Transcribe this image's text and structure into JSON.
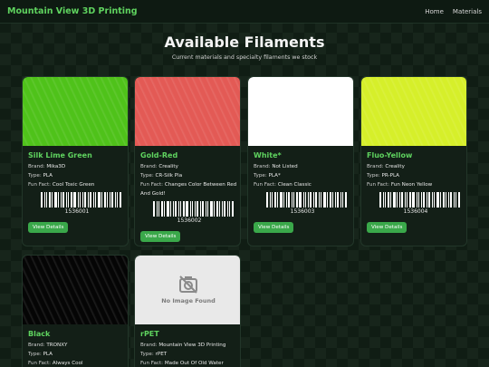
{
  "nav": {
    "brand": "Mountain View 3D Printing",
    "links": [
      "Home",
      "Materials"
    ]
  },
  "hero": {
    "title": "Available Filaments",
    "subtitle": "Current materials and specialty filaments we stock"
  },
  "labels": {
    "brand": "Brand:",
    "type": "Type:",
    "fun_fact": "Fun Fact:",
    "view_details": "View Details",
    "no_image": "No Image Found"
  },
  "filaments": [
    {
      "name": "Silk Lime Green",
      "brand": "Mika3D",
      "type": "PLA",
      "fun_fact": "Cool Toxic Green",
      "code": "1536001",
      "color": "#4fc21a"
    },
    {
      "name": "Gold-Red",
      "brand": "Creality",
      "type": "CR-Silk Pla",
      "fun_fact": "Changes Color Between Red And Gold!",
      "code": "1536002",
      "color": "#e35a55"
    },
    {
      "name": "White*",
      "brand": "Not Listed",
      "type": "PLA*",
      "fun_fact": "Clean Classic",
      "code": "1536003",
      "color": "#ffffff"
    },
    {
      "name": "Fluo-Yellow",
      "brand": "Creality",
      "type": "PR-PLA",
      "fun_fact": "Fun Neon Yellow",
      "code": "1536004",
      "color": "#d6ef2a"
    },
    {
      "name": "Black",
      "brand": "TRONXY",
      "type": "PLA",
      "fun_fact": "Always Cool",
      "code": "",
      "color": "#050505"
    },
    {
      "name": "rPET",
      "brand": "Mountain View 3D Printing",
      "type": "rPET",
      "fun_fact": "Made Out Of Old Water",
      "code": "",
      "color": ""
    }
  ]
}
